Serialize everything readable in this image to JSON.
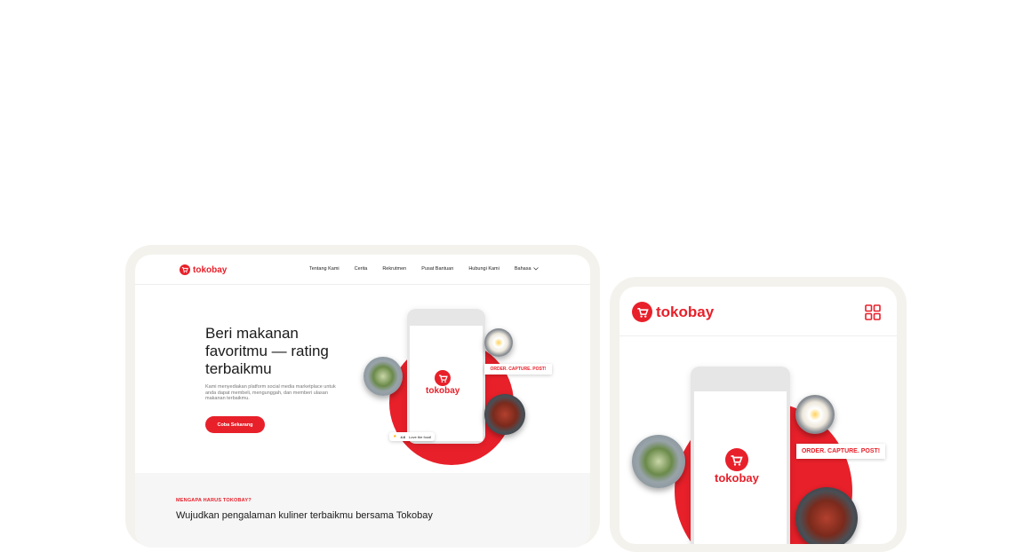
{
  "brand": {
    "name": "tokobay",
    "color": "#e8202a"
  },
  "desktop": {
    "nav": {
      "links": [
        "Tentang Kami",
        "Cerita",
        "Rekrutmen",
        "Pusat Bantuan",
        "Hubungi Kami",
        "Bahasa"
      ],
      "language_dropdown_icon": "chevron-down-icon"
    },
    "hero": {
      "title": "Beri makanan favoritmu — rating terbaikmu",
      "description": "Kami menyediakan platform social media marketplace untuk anda dapat membeli, mengunggah, dan memberi ulasan makanan terbaikmu.",
      "cta_label": "Coba Sekarang",
      "tag": "ORDER. CAPTURE. POST!",
      "rating": {
        "value": "4.6",
        "text": "Love the food!"
      }
    },
    "why": {
      "eyebrow": "MENGAPA HARUS TOKOBAY?",
      "title": "Wujudkan pengalaman kuliner terbaikmu bersama Tokobay"
    }
  },
  "mobile": {
    "menu_icon": "grid-menu-icon",
    "tag": "ORDER. CAPTURE. POST!"
  }
}
